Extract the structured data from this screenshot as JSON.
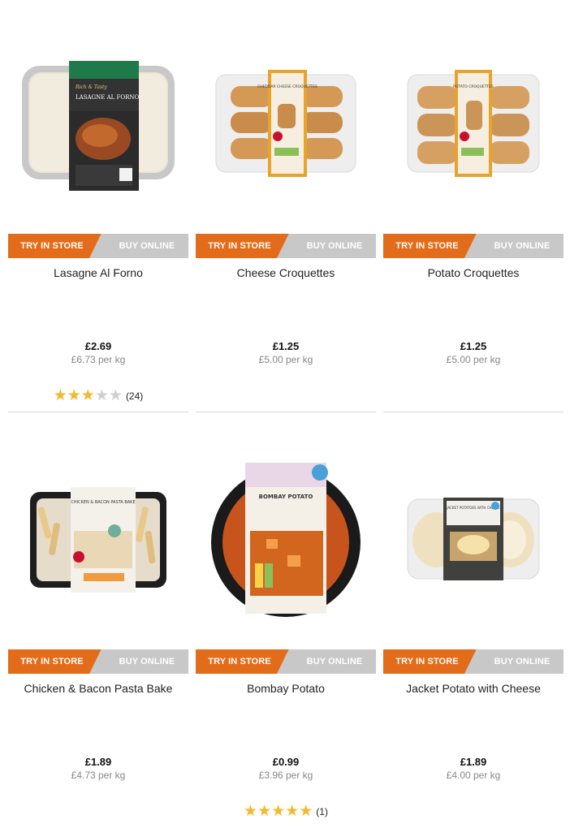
{
  "buttons": {
    "store": "TRY IN STORE",
    "online": "BUY ONLINE"
  },
  "colors": {
    "store": "#e36c1a",
    "online": "#c8c8c8",
    "star": "#f5b82e"
  },
  "products": [
    {
      "name": "Lasagne Al Forno",
      "price": "£2.69",
      "per_kg": "£6.73 per kg",
      "rating": 3,
      "reviews": "(24)",
      "pack_title": "LASAGNE AL FORNO",
      "pack_subtitle": "Rich & Tasty"
    },
    {
      "name": "Cheese Croquettes",
      "price": "£1.25",
      "per_kg": "£5.00 per kg",
      "pack_title": "CHEDDAR CHEESE CROQUETTES"
    },
    {
      "name": "Potato Croquettes",
      "price": "£1.25",
      "per_kg": "£5.00 per kg",
      "pack_title": "POTATO CROQUETTES"
    },
    {
      "name": "Chicken & Bacon Pasta Bake",
      "price": "£1.89",
      "per_kg": "£4.73 per kg",
      "pack_title": "CHICKEN & BACON PASTA BAKE"
    },
    {
      "name": "Bombay Potato",
      "price": "£0.99",
      "per_kg": "£3.96 per kg",
      "rating": 5,
      "reviews": "(1)",
      "pack_title": "BOMBAY POTATO"
    },
    {
      "name": "Jacket Potato with Cheese",
      "price": "£1.89",
      "per_kg": "£4.00 per kg",
      "pack_title": "JACKET POTATOES WITH CHEESE"
    }
  ]
}
